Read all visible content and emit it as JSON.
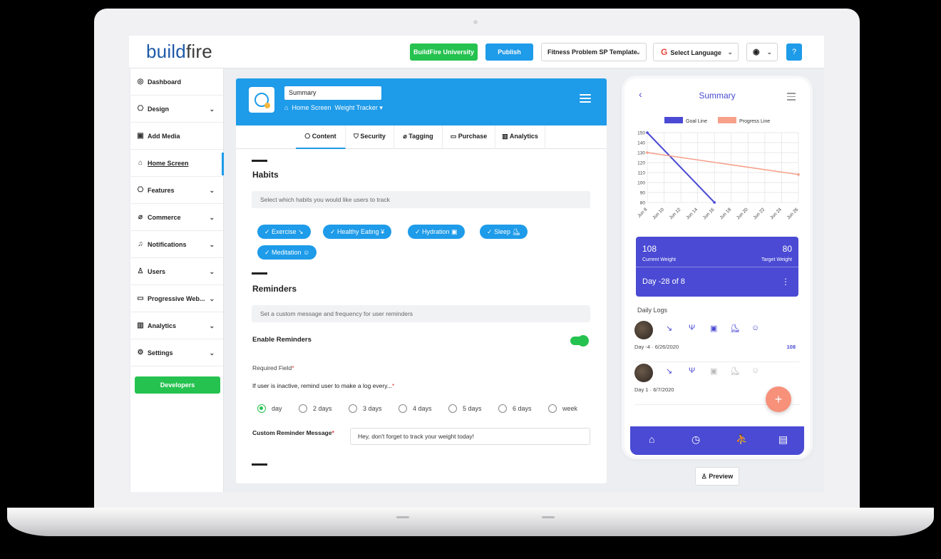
{
  "header": {
    "logo_build": "build",
    "logo_fire": "fire",
    "university_btn": "BuildFire University",
    "publish_btn": "Publish",
    "template_select": "Fitness Problem SP Template",
    "language_select": "Select Language",
    "language_icon": "G",
    "user_icon": "user-circle-icon",
    "help_icon": "help-icon"
  },
  "sidebar": {
    "items": [
      {
        "label": "Dashboard",
        "icon": "dashboard-icon",
        "glyph": "◎",
        "chevron": false
      },
      {
        "label": "Design",
        "icon": "palette-icon",
        "glyph": "⎔",
        "chevron": true
      },
      {
        "label": "Add Media",
        "icon": "media-icon",
        "glyph": "▣",
        "chevron": false
      },
      {
        "label": "Home Screen",
        "icon": "home-icon",
        "glyph": "⌂",
        "chevron": false,
        "active": true
      },
      {
        "label": "Features",
        "icon": "features-icon",
        "glyph": "⎔",
        "chevron": true
      },
      {
        "label": "Commerce",
        "icon": "tag-icon",
        "glyph": "⌀",
        "chevron": true
      },
      {
        "label": "Notifications",
        "icon": "bell-icon",
        "glyph": "♫",
        "chevron": true
      },
      {
        "label": "Users",
        "icon": "users-icon",
        "glyph": "♙",
        "chevron": true
      },
      {
        "label": "Progressive Web...",
        "icon": "pwa-icon",
        "glyph": "▭",
        "chevron": true
      },
      {
        "label": "Analytics",
        "icon": "analytics-icon",
        "glyph": "▥",
        "chevron": true
      },
      {
        "label": "Settings",
        "icon": "settings-icon",
        "glyph": "⚙",
        "chevron": true
      }
    ],
    "developers_btn": "Developers"
  },
  "editor": {
    "title_value": "Summary",
    "crumb_home": "Home Screen",
    "crumb_plugin": "Weight Tracker",
    "tabs": [
      {
        "label": "Content",
        "glyph": "⎔",
        "active": true
      },
      {
        "label": "Security",
        "glyph": "⛉"
      },
      {
        "label": "Tagging",
        "glyph": "⌀"
      },
      {
        "label": "Purchase",
        "glyph": "▭"
      },
      {
        "label": "Analytics",
        "glyph": "▥"
      }
    ],
    "habits": {
      "title": "Habits",
      "hint": "Select which habits you would like users to track",
      "chips": [
        {
          "label": "✓ Exercise ↘",
          "icon": "exercise-icon"
        },
        {
          "label": "✓ Healthy Eating ¥",
          "icon": "fork-knife-icon"
        },
        {
          "label": "✓ Hydration ▣",
          "icon": "cup-icon"
        },
        {
          "label": "✓ Sleep ⛸",
          "icon": "sleep-icon"
        },
        {
          "label": "✓ Meditation ☺",
          "icon": "smile-icon"
        }
      ]
    },
    "reminders": {
      "title": "Reminders",
      "hint": "Set a custom message and frequency for user reminders",
      "enable_label": "Enable Reminders",
      "enabled": true,
      "required_label": "Required Field",
      "inactive_label": "If user is inactive, remind user to make a log every...",
      "frequency_options": [
        "day",
        "2 days",
        "3 days",
        "4 days",
        "5 days",
        "6 days",
        "week"
      ],
      "selected_frequency": "day",
      "custom_label": "Custom Reminder Message",
      "custom_value": "Hey, don't forget to track your weight today!"
    }
  },
  "phone": {
    "title": "Summary",
    "back_icon": "chevron-left-icon",
    "menu_icon": "menu-icon",
    "current_weight": "108",
    "current_label": "Current Weight",
    "target_weight": "80",
    "target_label": "Target Weight",
    "day_text": "Day -28 of 8",
    "more_icon": "⋮",
    "logs_title": "Daily Logs",
    "logs": [
      {
        "date": "Day -4  ·  6/26/2020",
        "value": "108",
        "dim": false
      },
      {
        "date": "Day 1  ·  6/7/2020",
        "value": "",
        "dim": true
      }
    ],
    "log_glyphs": [
      "↘",
      "Ψ",
      "▣",
      "⛸",
      "☺"
    ],
    "fab": "+",
    "nav_icons": [
      {
        "name": "home-icon",
        "glyph": "⌂"
      },
      {
        "name": "timer-icon",
        "glyph": "◷"
      },
      {
        "name": "run-icon",
        "glyph": "⛹"
      },
      {
        "name": "journal-icon",
        "glyph": "▤"
      }
    ]
  },
  "preview_btn": "Preview",
  "chart_data": {
    "type": "line",
    "x": [
      "Jun 8",
      "Jun 10",
      "Jun 12",
      "Jun 14",
      "Jun 16",
      "Jun 18",
      "Jun 20",
      "Jun 22",
      "Jun 24",
      "Jun 26"
    ],
    "y_ticks": [
      80,
      90,
      100,
      110,
      120,
      130,
      140,
      150
    ],
    "ylim": [
      80,
      150
    ],
    "grid": true,
    "legend_position": "top",
    "series": [
      {
        "name": "Goal Line",
        "color": "#4a4ad4",
        "points": [
          [
            "Jun 8",
            150
          ],
          [
            "Jun 16",
            80
          ]
        ]
      },
      {
        "name": "Progress Line",
        "color": "#f7a08a",
        "points": [
          [
            "Jun 8",
            130
          ],
          [
            "Jun 26",
            108
          ]
        ]
      }
    ]
  }
}
